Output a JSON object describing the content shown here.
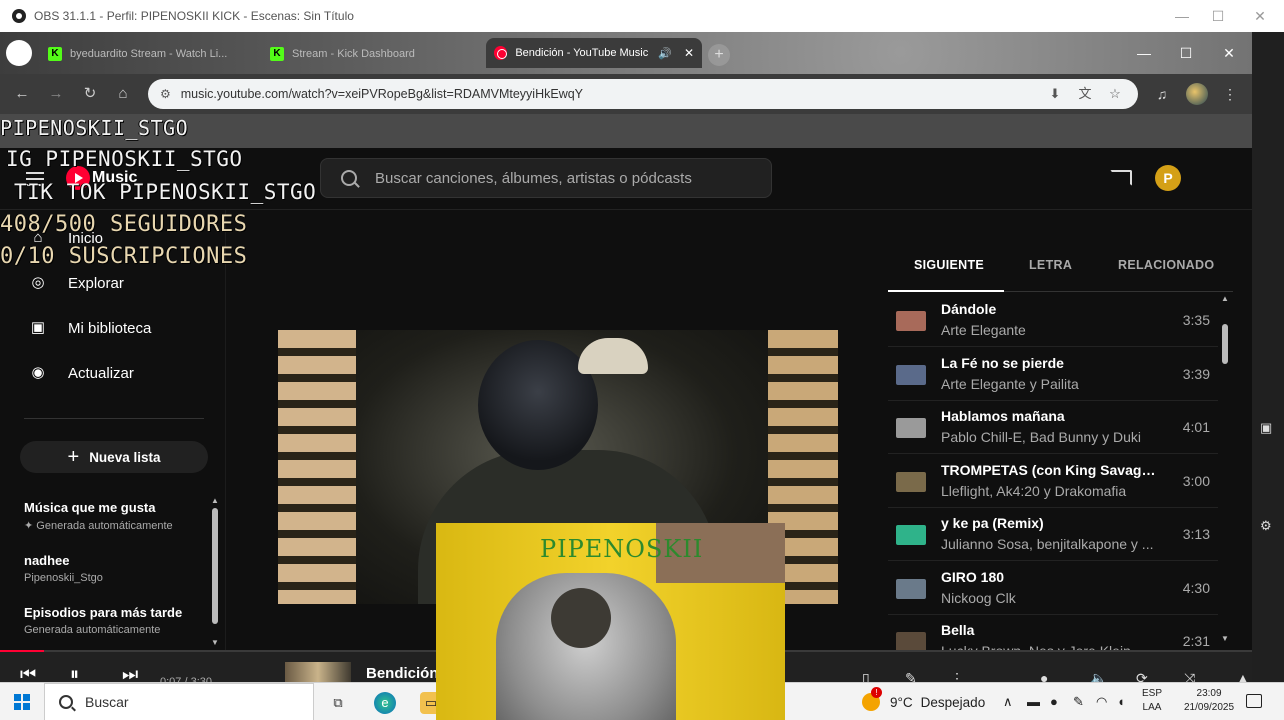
{
  "obs": {
    "title": "OBS 31.1.1 - Perfil: PIPENOSKII KICK - Escenas: Sin Título"
  },
  "browser": {
    "tabs": [
      {
        "label": "byeduardito Stream - Watch Li..."
      },
      {
        "label": "Stream - Kick Dashboard"
      },
      {
        "label": "Bendición - YouTube Music"
      }
    ],
    "url": "music.youtube.com/watch?v=xeiPVRopeBg&list=RDAMVMteyyiHkEwqY"
  },
  "overlay": {
    "line1": "PIPENOSKII_STGO",
    "line2": "IG PIPENOSKII_STGO",
    "line3": "TIK TOK PIPENOSKII_STGO",
    "line4": "408/500 SEGUIDORES",
    "line5": "0/10 SUSCRIPCIONES",
    "webcam_name": "PIPENOSKII"
  },
  "ytmusic": {
    "logo_text": "Music",
    "search_placeholder": "Buscar canciones, álbumes, artistas o pódcasts",
    "profile_initial": "P",
    "nav": [
      {
        "label": "Inicio",
        "icon": "home-icon"
      },
      {
        "label": "Explorar",
        "icon": "compass-icon"
      },
      {
        "label": "Mi biblioteca",
        "icon": "library-icon"
      },
      {
        "label": "Actualizar",
        "icon": "upgrade-icon"
      }
    ],
    "new_playlist": "Nueva lista",
    "playlists": [
      {
        "name": "Música que me gusta",
        "sub": "Generada automáticamente",
        "pinned": true
      },
      {
        "name": "nadhee",
        "sub": "Pipenoskii_Stgo",
        "pinned": false
      },
      {
        "name": "Episodios para más tarde",
        "sub": "Generada automáticamente",
        "pinned": false
      }
    ],
    "queue_tabs": [
      "SIGUIENTE",
      "LETRA",
      "RELACIONADO"
    ],
    "queue": [
      {
        "title": "Dándole",
        "artist": "Arte Elegante",
        "duration": "3:35",
        "thumb": "#a86a5a"
      },
      {
        "title": "La Fé no se pierde",
        "artist": "Arte Elegante y Pailita",
        "duration": "3:39",
        "thumb": "#5a6a8a"
      },
      {
        "title": "Hablamos mañana",
        "artist": "Pablo Chill-E, Bad Bunny y Duki",
        "duration": "4:01",
        "thumb": "#9a9a9a"
      },
      {
        "title": "TROMPETAS (con King Savagge)",
        "artist": "Lleflight, Ak4:20 y Drakomafia",
        "duration": "3:00",
        "thumb": "#7a6a4a"
      },
      {
        "title": "y ke pa (Remix)",
        "artist": "Julianno Sosa, benjitalkapone y ...",
        "duration": "3:13",
        "thumb": "#2fb38a"
      },
      {
        "title": "GIRO 180",
        "artist": "Nickoog Clk",
        "duration": "4:30",
        "thumb": "#6a7a8a"
      },
      {
        "title": "Bella",
        "artist": "Lucky Brown, Nes y Jere Klein",
        "duration": "2:31",
        "thumb": "#5a4a3a"
      }
    ],
    "player": {
      "now_playing": "Bendición",
      "time": "0:07 / 3:30",
      "progress": 0.035
    }
  },
  "taskbar": {
    "search_placeholder": "Buscar",
    "weather_temp": "9°C",
    "weather_desc": "Despejado",
    "lang_top": "ESP",
    "lang_bottom": "LAA",
    "time": "23:09",
    "date": "21/09/2025"
  },
  "colors": {
    "accent": "#ff0033",
    "background": "#0f0f0f",
    "kick_green": "#53fc18"
  }
}
